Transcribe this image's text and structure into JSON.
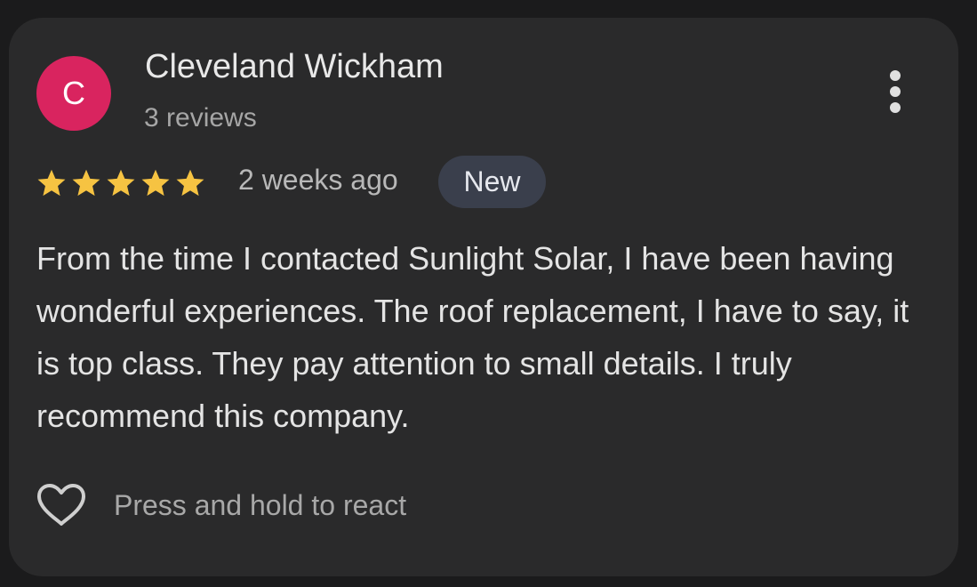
{
  "review": {
    "avatar_letter": "C",
    "avatar_color": "#d9245f",
    "author_name": "Cleveland Wickham",
    "author_review_count": "3 reviews",
    "rating": 5,
    "rating_max": 5,
    "star_color": "#f6c342",
    "time_ago": "2 weeks ago",
    "badge": "New",
    "text": "From the time I contacted Sunlight Solar, I have been having wonderful experiences. The roof replacement, I have to say, it is top class. They pay attention to small details. I truly recommend this company.",
    "react_label": "Press and hold to react"
  },
  "icons": {
    "more": "more-vert-icon",
    "star": "star-icon",
    "react": "heart-outline-icon"
  }
}
